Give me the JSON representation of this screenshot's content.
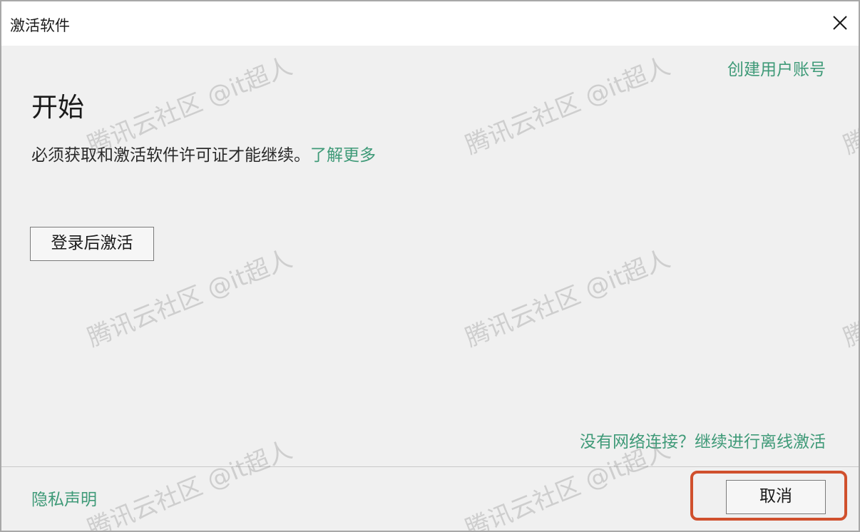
{
  "window": {
    "title": "激活软件",
    "close_icon": "close-icon"
  },
  "header": {
    "create_account_link": "创建用户账号"
  },
  "main": {
    "heading": "开始",
    "description": "必须获取和激活软件许可证才能继续。",
    "learn_more_link": "了解更多",
    "login_button": "登录后激活",
    "offline_link": "没有网络连接？继续进行离线激活"
  },
  "footer": {
    "privacy_link": "隐私声明",
    "cancel_button": "取消"
  },
  "watermark": {
    "text": "腾讯云社区 @it超人"
  },
  "colors": {
    "link": "#3f9a78",
    "highlight": "#d0502d",
    "background": "#f0f0f0"
  }
}
